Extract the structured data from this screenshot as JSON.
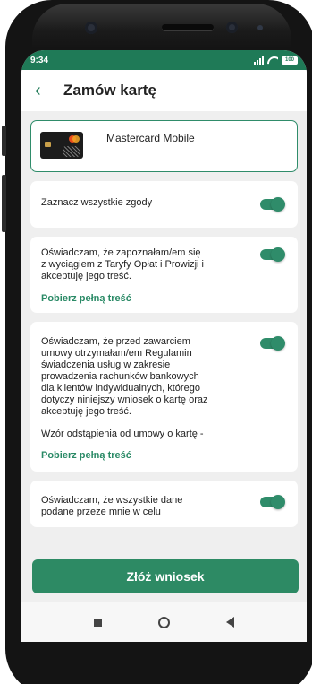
{
  "status_bar": {
    "time": "9:34",
    "battery": "100"
  },
  "header": {
    "back_icon": "chevron-left-icon",
    "title": "Zamów kartę"
  },
  "card": {
    "name": "Mastercard Mobile"
  },
  "consents": [
    {
      "text": "Zaznacz wszystkie zgody",
      "checked": true
    },
    {
      "text": "Oświadczam, że zapoznałam/em się\nz wyciągiem z Taryfy Opłat i Prowizji i\nakceptuję jego treść.",
      "link": "Pobierz pełną treść",
      "checked": true
    },
    {
      "text": "Oświadczam, że przed zawarciem\numowy otrzymałam/em Regulamin\nświadczenia usług w zakresie\nprowadzenia rachunków bankowych\ndla klientów indywidualnych, którego\ndotyczy niniejszy wniosek o kartę oraz\nakceptuję jego treść.",
      "extra": "Wzór odstąpienia od umowy o kartę -",
      "link": "Pobierz pełną treść",
      "checked": true
    },
    {
      "text": "Oświadczam, że wszystkie dane\npodane przeze mnie w celu",
      "checked": true
    }
  ],
  "submit_label": "Złóż wniosek",
  "colors": {
    "accent": "#2d8a64",
    "status_bar": "#1f7a57"
  }
}
